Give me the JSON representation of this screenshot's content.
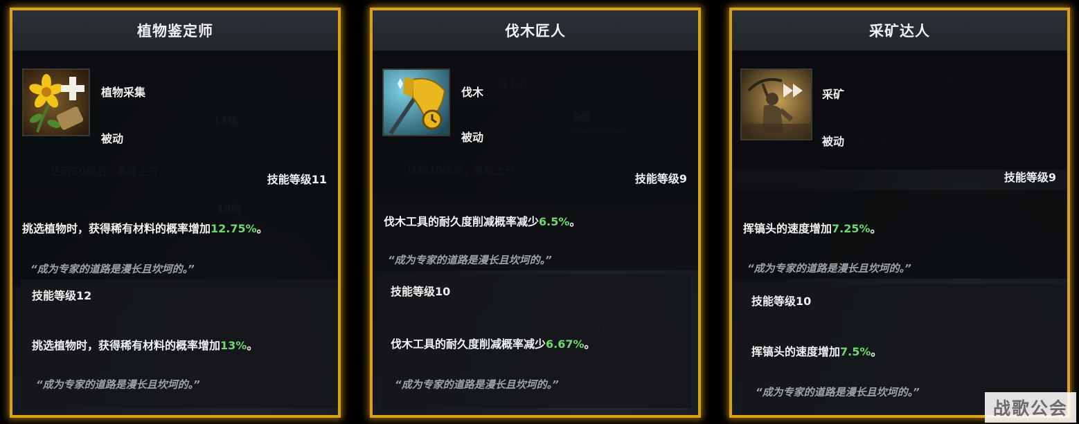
{
  "cards": [
    {
      "title": "植物鉴定师",
      "skill_name": "植物采集",
      "skill_type": "被动",
      "icon": "flower-plus-icon",
      "current_level": "技能等级11",
      "current_effect_text": "挑选植物时，获得稀有材料的概率增加",
      "current_effect_pct": "12.75%",
      "current_effect_end": "。",
      "current_quote": "“成为专家的道路是漫长且坎坷的。”",
      "next_level": "技能等级12",
      "next_effect_text": "挑选植物时，获得稀有材料的概率增加",
      "next_effect_pct": "13%",
      "next_effect_end": "。",
      "next_quote": "“成为专家的道路是漫长且坎坷的。”"
    },
    {
      "title": "伐木匠人",
      "skill_name": "伐木",
      "skill_type": "被动",
      "icon": "axe-clock-icon",
      "current_level": "技能等级9",
      "current_effect_text": "伐木工具的耐久度削减概率减少",
      "current_effect_pct": "6.5%",
      "current_effect_end": "。",
      "current_quote": "“成为专家的道路是漫长且坎坷的。”",
      "next_level": "技能等级10",
      "next_effect_text": "伐木工具的耐久度削减概率减少",
      "next_effect_pct": "6.67%",
      "next_effect_end": "。",
      "next_quote": "“成为专家的道路是漫长且坎坷的。”"
    },
    {
      "title": "采矿达人",
      "skill_name": "采矿",
      "skill_type": "被动",
      "icon": "miner-fastforward-icon",
      "current_level": "技能等级9",
      "current_effect_text": "挥镐头的速度增加",
      "current_effect_pct": "7.25%",
      "current_effect_end": "。",
      "current_quote": "“成为专家的道路是漫长且坎坷的。”",
      "next_level": "技能等级10",
      "next_effect_text": "挥镐头的速度增加",
      "next_effect_pct": "7.5%",
      "next_effect_end": "。",
      "next_quote": "“成为专家的道路是漫长且坎坷的。”"
    }
  ],
  "watermark": "战歌公会",
  "colors": {
    "border": "#d9a118",
    "percent": "#6fd86f",
    "quote": "#9ea3a8"
  }
}
